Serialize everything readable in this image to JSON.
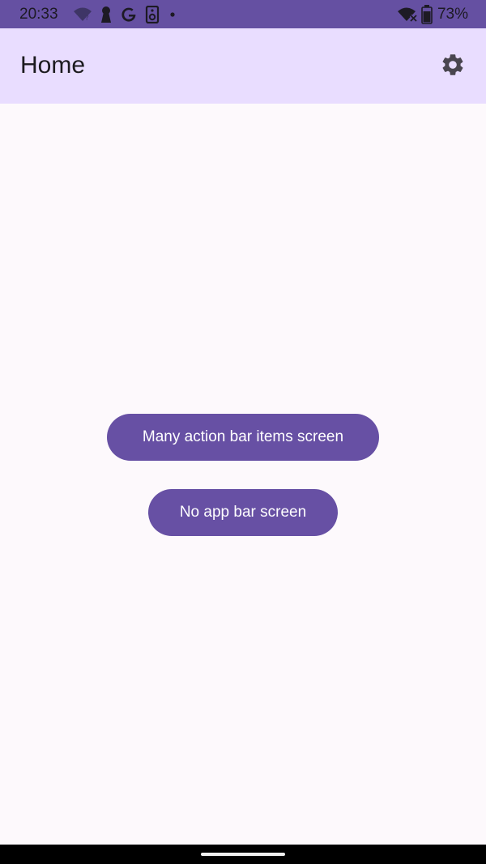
{
  "status_bar": {
    "time": "20:33",
    "battery_percent": "73%",
    "icons_left": [
      "wifi-question-icon",
      "keyhole-icon",
      "google-g-icon",
      "speaker-icon",
      "dot-icon"
    ],
    "icons_right": [
      "wifi-off-icon",
      "battery-icon"
    ],
    "background": "#6550a2"
  },
  "app_bar": {
    "title": "Home",
    "settings_icon": "gear-icon",
    "background": "#e9ddff"
  },
  "main": {
    "buttons": [
      {
        "label": "Many action bar items screen"
      },
      {
        "label": "No app bar screen"
      }
    ],
    "button_color": "#6750a4"
  }
}
